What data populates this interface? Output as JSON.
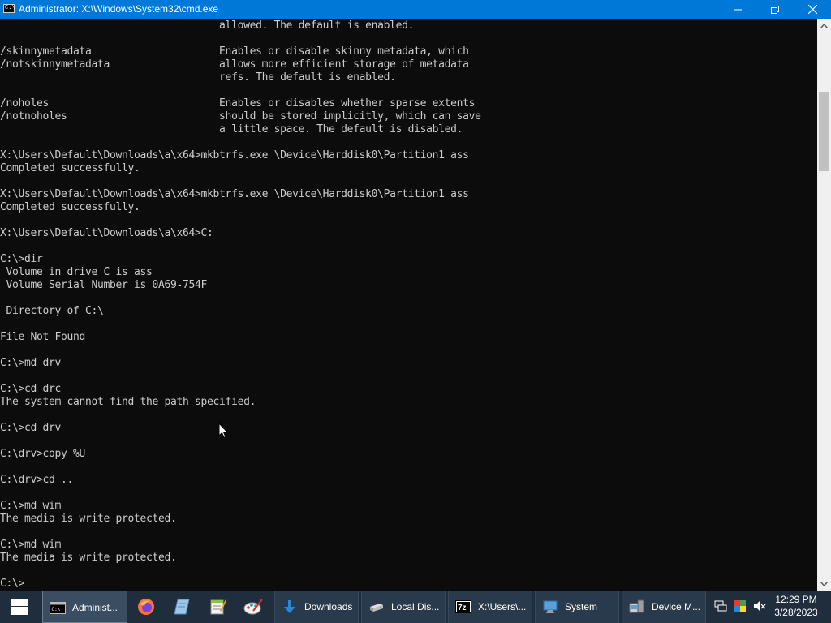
{
  "window": {
    "title": "Administrator: X:\\Windows\\System32\\cmd.exe",
    "icon_text": "C:\\"
  },
  "console": {
    "lines": [
      "                                    allowed. The default is enabled.",
      "",
      "/skinnymetadata                     Enables or disable skinny metadata, which",
      "/notskinnymetadata                  allows more efficient storage of metadata",
      "                                    refs. The default is enabled.",
      "",
      "/noholes                            Enables or disables whether sparse extents",
      "/notnoholes                         should be stored implicitly, which can save",
      "                                    a little space. The default is disabled.",
      "",
      "X:\\Users\\Default\\Downloads\\a\\x64>mkbtrfs.exe \\Device\\Harddisk0\\Partition1 ass",
      "Completed successfully.",
      "",
      "X:\\Users\\Default\\Downloads\\a\\x64>mkbtrfs.exe \\Device\\Harddisk0\\Partition1 ass",
      "Completed successfully.",
      "",
      "X:\\Users\\Default\\Downloads\\a\\x64>C:",
      "",
      "C:\\>dir",
      " Volume in drive C is ass",
      " Volume Serial Number is 0A69-754F",
      "",
      " Directory of C:\\",
      "",
      "File Not Found",
      "",
      "C:\\>md drv",
      "",
      "C:\\>cd drc",
      "The system cannot find the path specified.",
      "",
      "C:\\>cd drv",
      "",
      "C:\\drv>copy %U",
      "",
      "C:\\drv>cd ..",
      "",
      "C:\\>md wim",
      "The media is write protected.",
      "",
      "C:\\>md wim",
      "The media is write protected.",
      "",
      "C:\\>"
    ]
  },
  "taskbar": {
    "items": [
      {
        "label": "Administ...",
        "icon": "cmd-icon"
      },
      {
        "label": "Downloads",
        "icon": "downloads-folder-icon"
      },
      {
        "label": "Local Dis...",
        "icon": "local-disk-icon"
      },
      {
        "label": "X:\\Users\\...",
        "icon": "7zip-icon"
      },
      {
        "label": "System",
        "icon": "system-icon"
      },
      {
        "label": "Device M...",
        "icon": "device-manager-icon"
      }
    ],
    "pinned": [
      "firefox-icon",
      "notepad-icon",
      "notepadpp-icon",
      "paint-icon"
    ],
    "tray": [
      "network-icon",
      "color-icon",
      "volume-muted-icon"
    ]
  },
  "clock": {
    "time": "12:29 PM",
    "date": "3/28/2023"
  },
  "colors": {
    "titlebar": "#0078d7",
    "console_bg": "#0c0c0c",
    "console_text": "#cccccc",
    "taskbar": "#1f2d3d"
  }
}
